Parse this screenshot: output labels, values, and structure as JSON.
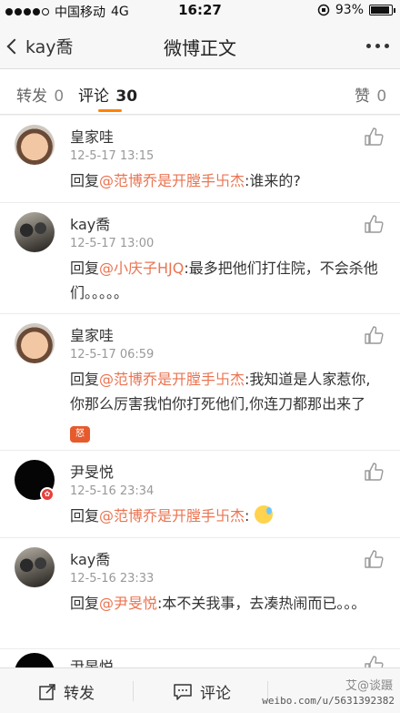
{
  "status_bar": {
    "carrier": "中国移动",
    "network": "4G",
    "time": "16:27",
    "battery": "93%",
    "battery_level": 0.93
  },
  "nav": {
    "back_label": "kay喬",
    "title": "微博正文"
  },
  "tabs": [
    {
      "label": "转发",
      "count": "0"
    },
    {
      "label": "评论",
      "count": "30"
    },
    {
      "label": "赞",
      "count": "0"
    }
  ],
  "comments": [
    {
      "name": "皇家哇",
      "time": "12-5-17 13:15",
      "prefix": "回复",
      "mention": "@范博乔是开膛手卐杰",
      "body": ":谁来的?"
    },
    {
      "name": "kay喬",
      "time": "12-5-17 13:00",
      "prefix": "回复",
      "mention": "@小庆子HJQ",
      "body": ":最多把他们打住院，不会杀他们。。。。。"
    },
    {
      "name": "皇家哇",
      "time": "12-5-17 06:59",
      "prefix": "回复",
      "mention": "@范博乔是开膛手卐杰",
      "body": ":我知道是人家惹你,你那么厉害我怕你打死他们,你连刀都那出来了",
      "emoji": "怒"
    },
    {
      "name": "尹旻悦",
      "time": "12-5-16 23:34",
      "prefix": "回复",
      "mention": "@范博乔是开膛手卐杰",
      "body": ":"
    },
    {
      "name": "kay喬",
      "time": "12-5-16 23:33",
      "prefix": "回复",
      "mention": "@尹旻悦",
      "body": ":本不关我事，去凑热闹而已。。。"
    },
    {
      "name": "尹旻悦"
    }
  ],
  "bottom": {
    "repost_label": "转发",
    "comment_label": "评论"
  },
  "watermark": {
    "logo_text": "艾@谈蹑",
    "url": "weibo.com/u/5631392382"
  },
  "colors": {
    "accent": "#ff8200",
    "mention": "#eb7350"
  }
}
